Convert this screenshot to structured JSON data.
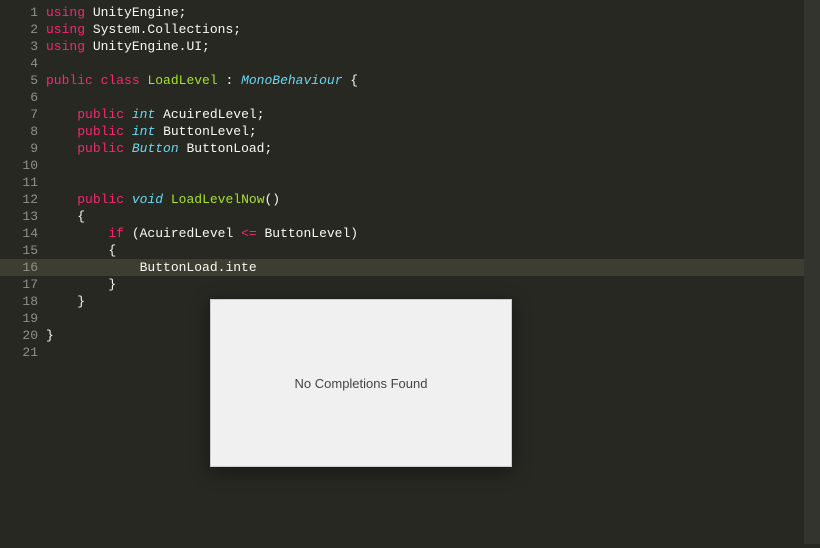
{
  "completion": {
    "message": "No Completions Found"
  },
  "lines": {
    "l1": {
      "k1": "using",
      "p1": " ",
      "id": "UnityEngine",
      "p2": ";"
    },
    "l2": {
      "k1": "using",
      "p1": " ",
      "id": "System.Collections",
      "p2": ";"
    },
    "l3": {
      "k1": "using",
      "p1": " ",
      "id": "UnityEngine.UI",
      "p2": ";"
    },
    "l4": {
      "content": ""
    },
    "l5": {
      "k1": "public",
      "p1": " ",
      "k2": "class",
      "p2": " ",
      "cls": "LoadLevel",
      "p3": " : ",
      "t": "MonoBehaviour",
      "p4": " {"
    },
    "l6": {
      "content": ""
    },
    "l7": {
      "pad": "    ",
      "k1": "public",
      "p1": " ",
      "t": "int",
      "p2": " ",
      "id": "AcuiredLevel",
      "p3": ";"
    },
    "l8": {
      "pad": "    ",
      "k1": "public",
      "p1": " ",
      "t": "int",
      "p2": " ",
      "id": "ButtonLevel",
      "p3": ";"
    },
    "l9": {
      "pad": "    ",
      "k1": "public",
      "p1": " ",
      "t": "Button",
      "p2": " ",
      "id": "ButtonLoad",
      "p3": ";"
    },
    "l10": {
      "content": ""
    },
    "l11": {
      "content": ""
    },
    "l12": {
      "pad": "    ",
      "k1": "public",
      "p1": " ",
      "t": "void",
      "p2": " ",
      "fn": "LoadLevelNow",
      "p3": "()"
    },
    "l13": {
      "pad": "    ",
      "p1": "{"
    },
    "l14": {
      "pad": "        ",
      "k1": "if",
      "p1": " (AcuiredLevel ",
      "op": "<=",
      "p2": " ButtonLevel)"
    },
    "l15": {
      "pad": "        ",
      "p1": "{"
    },
    "l16": {
      "pad": "            ",
      "p1": "ButtonLoad.inte"
    },
    "l17": {
      "pad": "        ",
      "p1": "}"
    },
    "l18": {
      "pad": "    ",
      "p1": "}"
    },
    "l19": {
      "content": ""
    },
    "l20": {
      "p1": "}"
    },
    "l21": {
      "content": ""
    }
  },
  "linenos": {
    "n1": "1",
    "n2": "2",
    "n3": "3",
    "n4": "4",
    "n5": "5",
    "n6": "6",
    "n7": "7",
    "n8": "8",
    "n9": "9",
    "n10": "10",
    "n11": "11",
    "n12": "12",
    "n13": "13",
    "n14": "14",
    "n15": "15",
    "n16": "16",
    "n17": "17",
    "n18": "18",
    "n19": "19",
    "n20": "20",
    "n21": "21"
  }
}
